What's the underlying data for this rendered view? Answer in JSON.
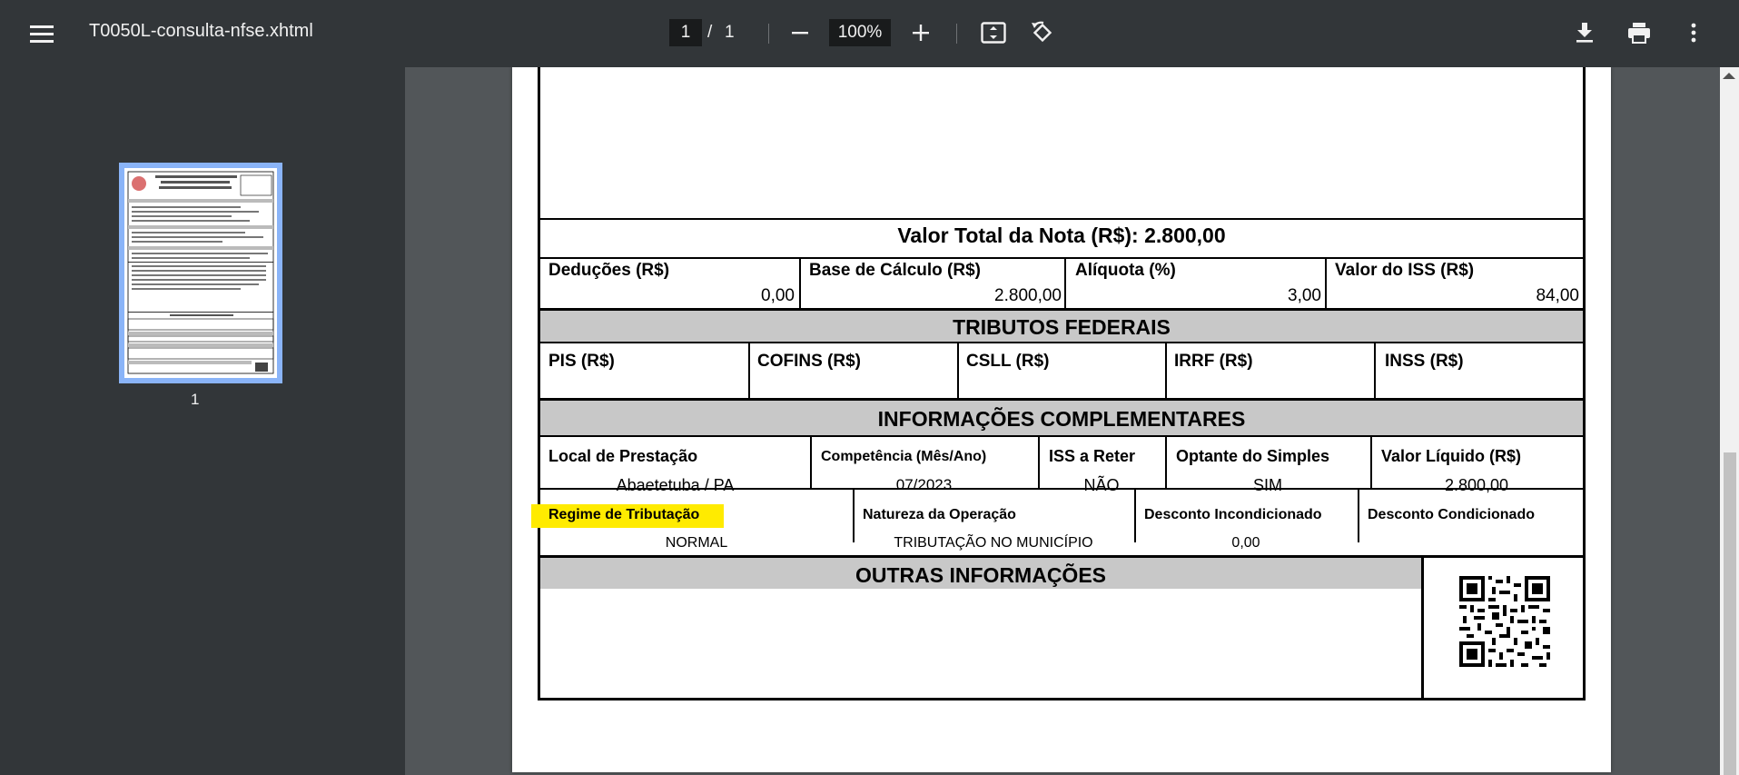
{
  "toolbar": {
    "file_name": "T0050L-consulta-nfse.xhtml",
    "page_current": "1",
    "page_separator": "/",
    "page_total": "1",
    "zoom": "100%"
  },
  "sidebar": {
    "thumbnail_label": "1"
  },
  "doc": {
    "valor_total": "Valor Total da Nota (R$): 2.800,00",
    "row1": [
      {
        "label": "Deduções (R$)",
        "value": "0,00"
      },
      {
        "label": "Base de Cálculo (R$)",
        "value": "2.800,00"
      },
      {
        "label": "Alíquota (%)",
        "value": "3,00"
      },
      {
        "label": "Valor do ISS (R$)",
        "value": "84,00"
      }
    ],
    "tributos_title": "TRIBUTOS FEDERAIS",
    "tributos": [
      "PIS (R$)",
      "COFINS (R$)",
      "CSLL (R$)",
      "IRRF (R$)",
      "INSS (R$)"
    ],
    "info_title": "INFORMAÇÕES COMPLEMENTARES",
    "info_row1": [
      {
        "label": "Local de Prestação",
        "value": "Abaetetuba / PA"
      },
      {
        "label": "Competência (Mês/Ano)",
        "value": "07/2023"
      },
      {
        "label": "ISS a Reter",
        "value": "NÃO"
      },
      {
        "label": "Optante do Simples",
        "value": "SIM"
      },
      {
        "label": "Valor Líquido (R$)",
        "value": "2.800,00"
      }
    ],
    "info_row2": [
      {
        "label": "Regime de Tributação",
        "value": "NORMAL"
      },
      {
        "label": "Natureza da Operação",
        "value": "TRIBUTAÇÃO NO MUNICÍPIO"
      },
      {
        "label": "Desconto Incondicionado",
        "value": "0,00"
      },
      {
        "label": "Desconto Condicionado",
        "value": ""
      }
    ],
    "outras_title": "OUTRAS INFORMAÇÕES"
  },
  "colors": {
    "toolbar_bg": "#323639",
    "viewer_bg": "#525659",
    "thumb_border": "#8ab4f8",
    "highlight": "#ffeb00",
    "section_gray": "#c8c8c8"
  },
  "icons": [
    "menu-icon",
    "minus-icon",
    "plus-icon",
    "fit-page-icon",
    "rotate-icon",
    "download-icon",
    "print-icon",
    "more-vert-icon",
    "qr-code-icon"
  ]
}
